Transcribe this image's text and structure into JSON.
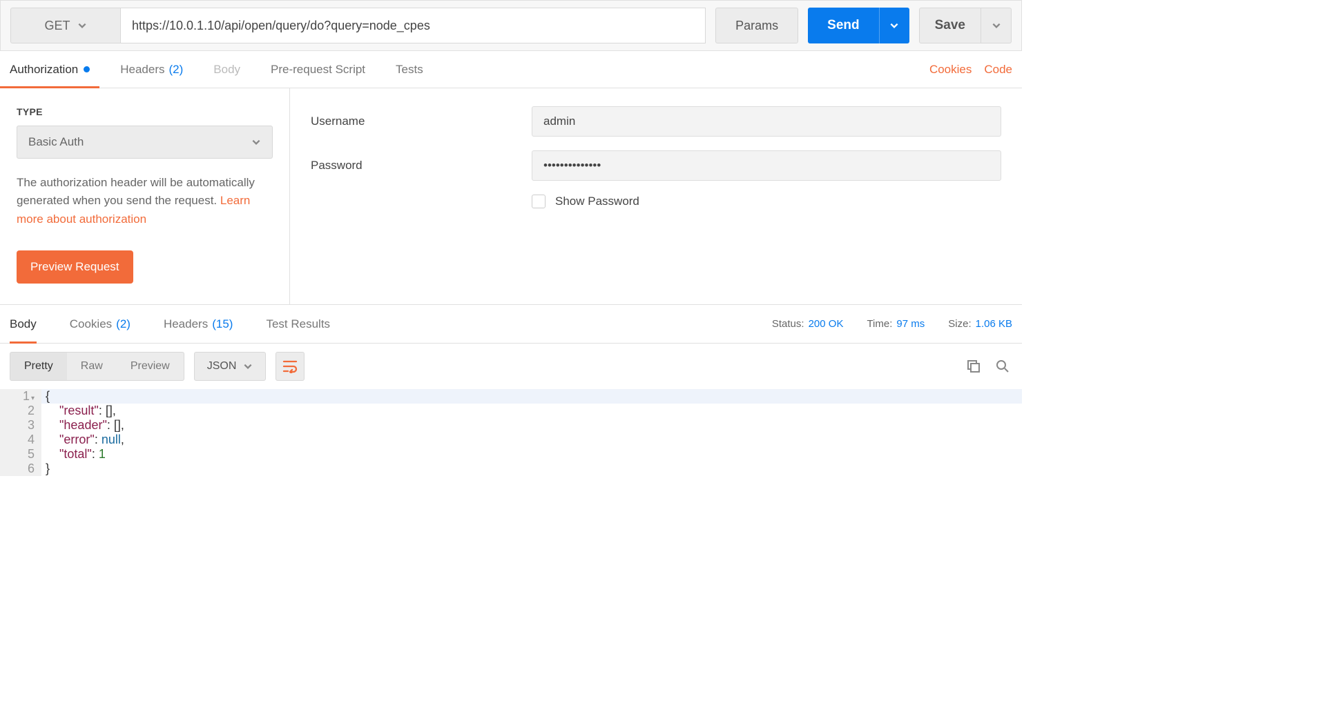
{
  "request": {
    "method": "GET",
    "url": "https://10.0.1.10/api/open/query/do?query=node_cpes",
    "params_btn": "Params",
    "send_btn": "Send",
    "save_btn": "Save"
  },
  "req_tabs": {
    "authorization": "Authorization",
    "headers": "Headers",
    "headers_count": "(2)",
    "body": "Body",
    "prescript": "Pre-request Script",
    "tests": "Tests",
    "cookies_link": "Cookies",
    "code_link": "Code"
  },
  "auth": {
    "type_label": "TYPE",
    "type_value": "Basic Auth",
    "help_pre": "The authorization header will be automatically generated when you send the request. ",
    "help_link": "Learn more about authorization",
    "preview_btn": "Preview Request",
    "username_label": "Username",
    "username_value": "admin",
    "password_label": "Password",
    "password_value": "••••••••••••••",
    "show_pw_label": "Show Password"
  },
  "resp_tabs": {
    "body": "Body",
    "cookies": "Cookies",
    "cookies_count": "(2)",
    "headers": "Headers",
    "headers_count": "(15)",
    "tests": "Test Results"
  },
  "resp_meta": {
    "status_label": "Status:",
    "status_value": "200 OK",
    "time_label": "Time:",
    "time_value": "97 ms",
    "size_label": "Size:",
    "size_value": "1.06 KB"
  },
  "body_toolbar": {
    "pretty": "Pretty",
    "raw": "Raw",
    "preview": "Preview",
    "format": "JSON"
  },
  "response_body": {
    "lines": [
      "1",
      "2",
      "3",
      "4",
      "5",
      "6"
    ],
    "l1": "{",
    "l2_k": "\"result\"",
    "l2_v": ": [],",
    "l3_k": "\"header\"",
    "l3_v": ": [],",
    "l4_k": "\"error\"",
    "l4_v1": ": ",
    "l4_null": "null",
    "l4_v2": ",",
    "l5_k": "\"total\"",
    "l5_v1": ": ",
    "l5_num": "1",
    "l6": "}"
  }
}
